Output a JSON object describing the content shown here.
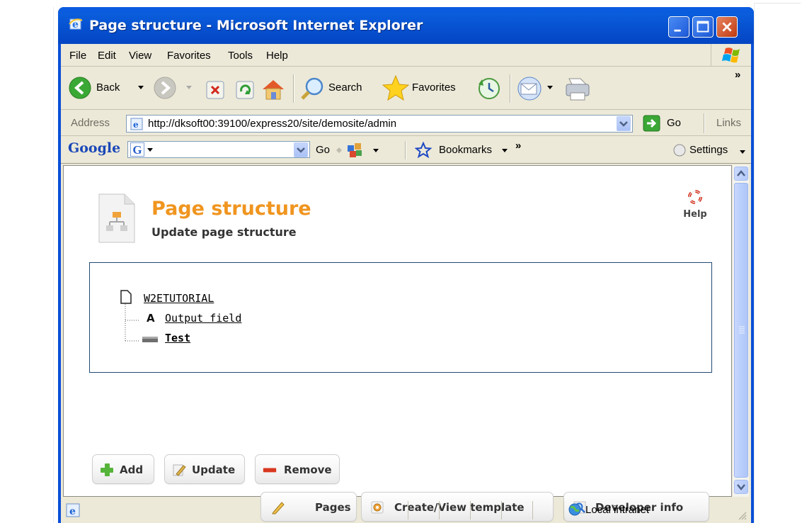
{
  "window": {
    "title": "Page structure - Microsoft Internet Explorer"
  },
  "menubar": {
    "items": [
      "File",
      "Edit",
      "View",
      "Favorites",
      "Tools",
      "Help"
    ]
  },
  "toolbar": {
    "back_label": "Back",
    "search_label": "Search",
    "favorites_label": "Favorites",
    "overflow": "»"
  },
  "addressbar": {
    "label": "Address",
    "url": "http://dksoft00:39100/express20/site/demosite/admin",
    "go_label": "Go",
    "links_label": "Links"
  },
  "googlebar": {
    "brand": "Google",
    "go_label": "Go",
    "bookmarks_label": "Bookmarks",
    "overflow": "»",
    "settings_label": "Settings"
  },
  "page": {
    "title": "Page structure",
    "subtitle": "Update page structure",
    "help_label": "Help",
    "tree": {
      "root": "W2ETUTORIAL",
      "children": [
        {
          "icon_text": "A",
          "label": "Output field"
        },
        {
          "label": "Test"
        }
      ]
    },
    "buttons": {
      "add": "Add",
      "update": "Update",
      "remove": "Remove",
      "pages": "Pages",
      "create_view_template": "Create/View template",
      "developer_info": "Developer info"
    }
  },
  "statusbar": {
    "zone": "Local intranet"
  },
  "colors": {
    "title_orange": "#f0951f",
    "xp_blue": "#0a4fd6",
    "tree_border": "#234a75"
  }
}
